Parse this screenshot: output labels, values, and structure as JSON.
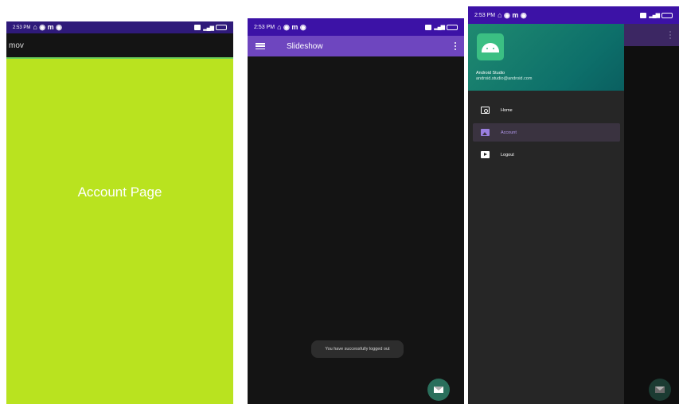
{
  "panel_account": {
    "status_time": "2:53 PM",
    "app_title": "mov",
    "page_text": "Account Page"
  },
  "panel_slideshow": {
    "status_time": "2:53 PM",
    "app_title": "Slideshow",
    "toast": "You have successfully logged out"
  },
  "panel_drawer": {
    "status_time": "2:53 PM",
    "header_name": "Android Studio",
    "header_email": "android.studio@android.com",
    "nav_items": [
      {
        "label": "Home",
        "icon": "camera-icon"
      },
      {
        "label": "Account",
        "icon": "gallery-icon",
        "active": true
      },
      {
        "label": "Logout",
        "icon": "slideshow-icon"
      }
    ]
  },
  "colors": {
    "status_bar": "#3c12a6",
    "app_bar": "#6e46bf",
    "account_background": "#b9e31f",
    "fab": "#2a6f5c"
  }
}
